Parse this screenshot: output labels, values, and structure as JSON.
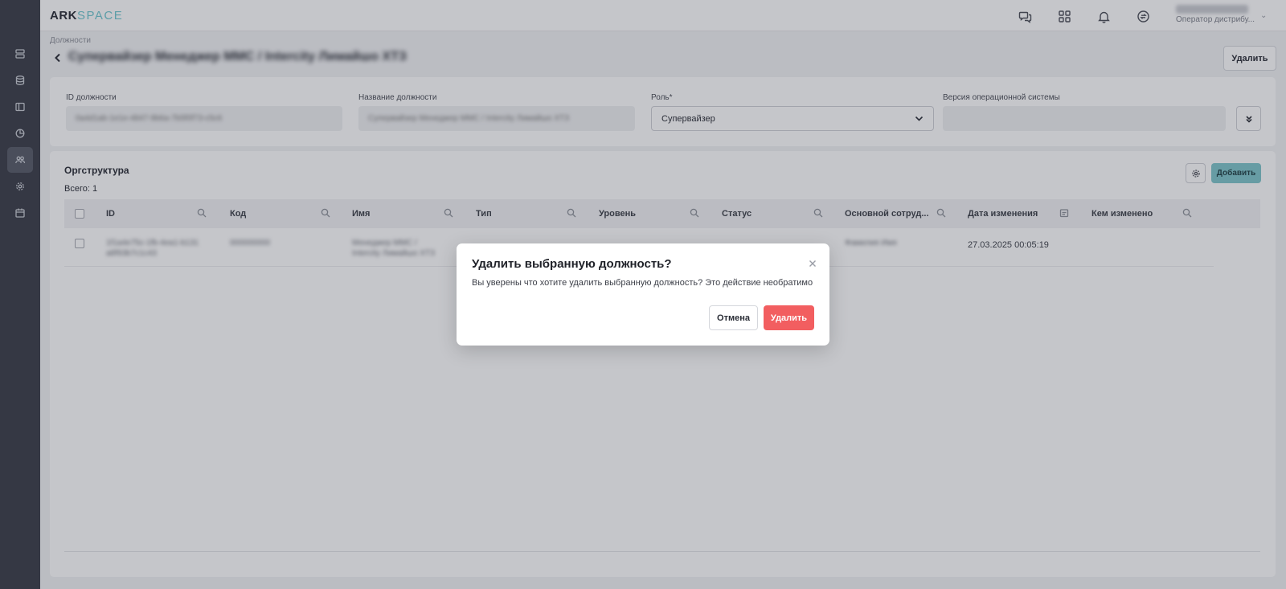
{
  "app": {
    "logo_main": "ARK",
    "logo_accent": "SPACE"
  },
  "header": {
    "icons": [
      "chat-icon",
      "apps-grid-icon",
      "bell-icon",
      "sync-icon"
    ],
    "user_role": "Оператор дистрибу..."
  },
  "sidebar": {
    "icons": [
      "server-icon",
      "database-icon",
      "layout-icon",
      "chart-pie-icon",
      "users-icon",
      "settings-icon",
      "calendar-icon"
    ],
    "active_index": 4
  },
  "breadcrumb": "Должности",
  "page": {
    "title": "Супервайзер Менеджер ММС / Intercity Лимайшо ХТЗ",
    "delete_label": "Удалить"
  },
  "fields": {
    "id_label": "ID должности",
    "id_value": "0a4d1ab-1e1e-4847-9b6a-7b5f0f73-c5c6",
    "name_label": "Название должности",
    "name_value": "Супервайзер Менеджер ММС / Intercity Лимайшо ХТЗ",
    "role_label": "Роль*",
    "role_value": "Супервайзер",
    "os_label": "Версия операционной системы",
    "os_value": ""
  },
  "orgstructure": {
    "title": "Оргструктура",
    "total": "Всего: 1",
    "add_label": "Добавить",
    "columns": [
      "ID",
      "Код",
      "Имя",
      "Тип",
      "Уровень",
      "Статус",
      "Основной сотруд...",
      "Дата изменения",
      "Кем изменено"
    ],
    "row": {
      "id": "1f1a4e75c-1fb-4ea1-b131\na8f93b7c1c43",
      "code": "000000000",
      "name": "Менеджер ММС /\nIntercity Лимайшо ХТЗ",
      "employee": "Фамилия Имя",
      "date": "27.03.2025 00:05:19"
    }
  },
  "modal": {
    "title": "Удалить выбранную должность?",
    "text": "Вы уверены что хотите удалить выбранную должность? Это действие необратимо",
    "cancel_label": "Отмена",
    "confirm_label": "Удалить"
  },
  "colors": {
    "accent": "#6fc7cf",
    "danger": "#f25e60",
    "sidebar": "#3a3d48"
  }
}
